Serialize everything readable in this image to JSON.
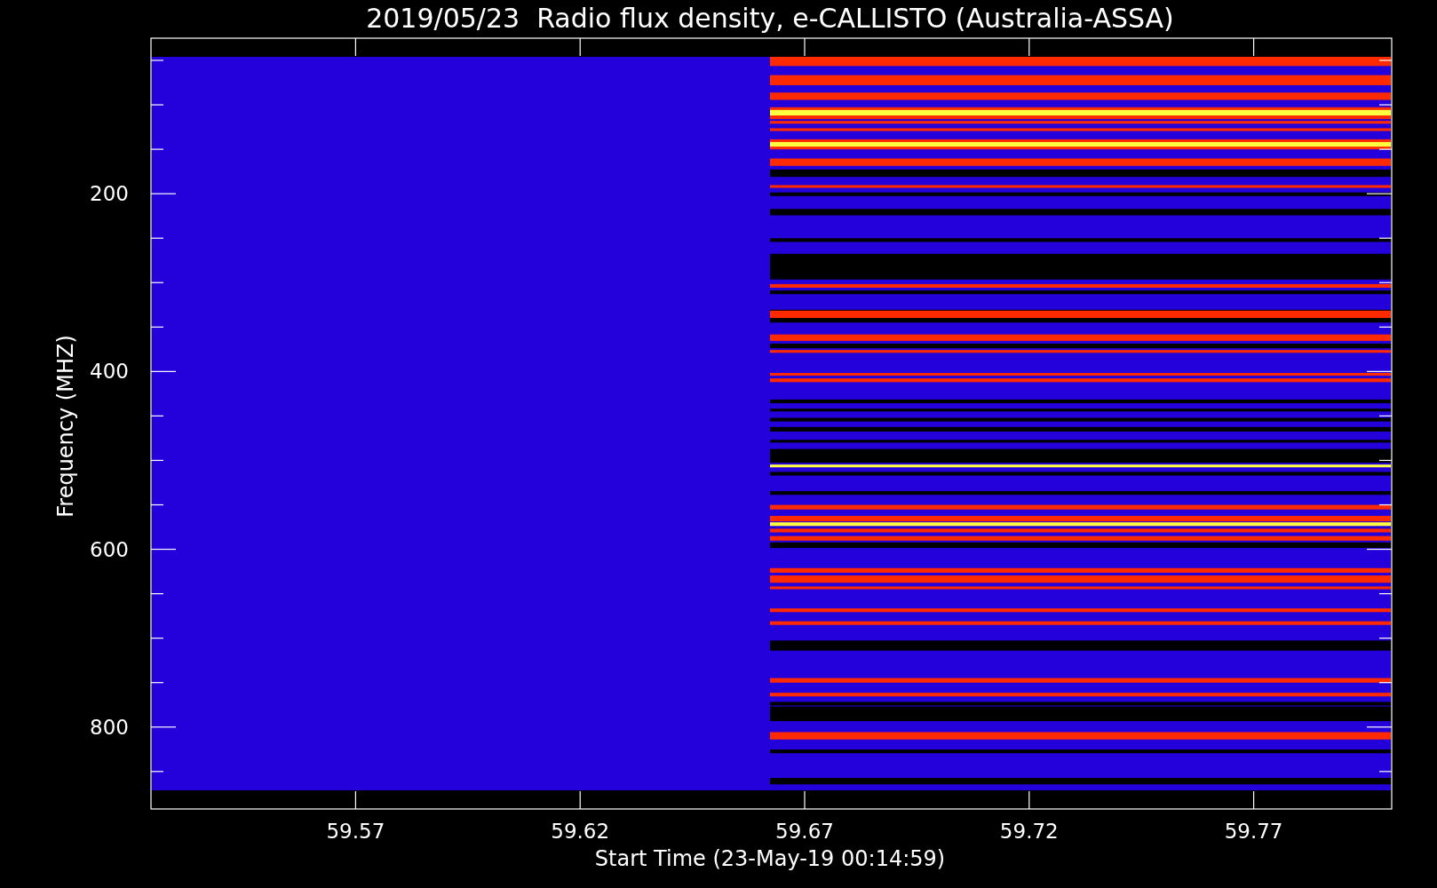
{
  "chart": {
    "title": "2019/05/23  Radio flux density, e-CALLISTO (Australia-ASSA)",
    "ylabel": "Frequency (MHZ)",
    "xlabel": "Start Time (23-May-19 00:14:59)",
    "y_tick_labels": [
      "200",
      "400",
      "600",
      "800"
    ],
    "x_tick_labels": [
      "59.57",
      "59.62",
      "59.67",
      "59.72",
      "59.77"
    ]
  }
}
